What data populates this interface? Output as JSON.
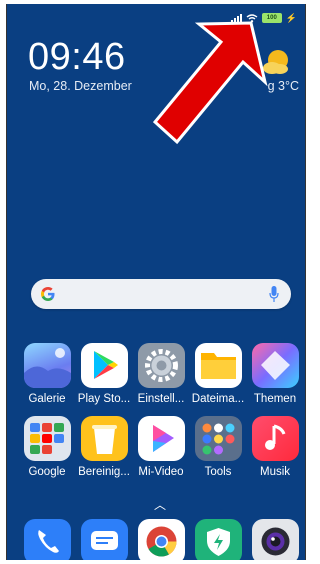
{
  "status": {
    "battery": "100"
  },
  "clock": {
    "time": "09:46",
    "date": "Mo, 28. Dezember"
  },
  "weather": {
    "text": "g 3°C",
    "icon": "partly-cloudy-icon"
  },
  "search": {
    "icon": "google-g-icon",
    "voice": "mic-icon"
  },
  "apps_row1": [
    {
      "label": "Galerie"
    },
    {
      "label": "Play Sto..."
    },
    {
      "label": "Einstell..."
    },
    {
      "label": "Dateima..."
    },
    {
      "label": "Themen"
    }
  ],
  "apps_row2": [
    {
      "label": "Google"
    },
    {
      "label": "Bereinig..."
    },
    {
      "label": "Mi-Video"
    },
    {
      "label": "Tools"
    },
    {
      "label": "Musik"
    }
  ],
  "dock": [
    {
      "icon": "phone-icon"
    },
    {
      "icon": "messages-icon"
    },
    {
      "icon": "chrome-icon"
    },
    {
      "icon": "security-icon"
    },
    {
      "icon": "camera-icon"
    }
  ],
  "colors": {
    "wallpaper": "#0a3f82",
    "arrow": "#e00000"
  }
}
